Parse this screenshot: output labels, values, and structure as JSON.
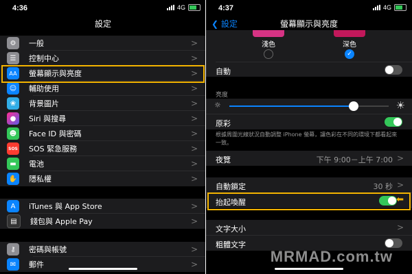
{
  "left": {
    "status_time": "4:36",
    "network": "4G",
    "title": "設定",
    "group1": [
      {
        "label": "一般",
        "icon": "gear-icon",
        "color": "#8e8e93"
      },
      {
        "label": "控制中心",
        "icon": "control-center-icon",
        "color": "#8e8e93"
      },
      {
        "label": "螢幕顯示與亮度",
        "icon": "display-icon",
        "color": "#0a84ff"
      },
      {
        "label": "輔助使用",
        "icon": "accessibility-icon",
        "color": "#0a84ff"
      },
      {
        "label": "背景圖片",
        "icon": "wallpaper-icon",
        "color": "#32ade6"
      },
      {
        "label": "Siri 與搜尋",
        "icon": "siri-icon",
        "color": "#222222"
      },
      {
        "label": "Face ID 與密碼",
        "icon": "faceid-icon",
        "color": "#34c759"
      },
      {
        "label": "SOS 緊急服務",
        "icon": "sos-icon",
        "color": "#ff3b30"
      },
      {
        "label": "電池",
        "icon": "battery-icon",
        "color": "#34c759"
      },
      {
        "label": "隱私權",
        "icon": "hand-icon",
        "color": "#0a84ff"
      }
    ],
    "group2": [
      {
        "label": "iTunes 與 App Store",
        "icon": "appstore-icon",
        "color": "#0a84ff"
      },
      {
        "label": "錢包與 Apple Pay",
        "icon": "wallet-icon",
        "color": "#1c1c1e"
      }
    ],
    "group3": [
      {
        "label": "密碼與帳號",
        "icon": "key-icon",
        "color": "#8e8e93"
      },
      {
        "label": "郵件",
        "icon": "mail-icon",
        "color": "#0a84ff"
      }
    ]
  },
  "right": {
    "status_time": "4:37",
    "network": "4G",
    "back_label": "設定",
    "title": "螢幕顯示與亮度",
    "light_label": "淺色",
    "dark_label": "深色",
    "auto_label": "自動",
    "brightness_section": "亮度",
    "brightness_level": 0.78,
    "true_tone_label": "原彩",
    "true_tone_desc": "根據周圍光線狀況自動調整 iPhone 螢幕，讓色彩在不同的環境下都看起來一致。",
    "night_shift_label": "夜覽",
    "night_shift_value": "下午 9:00－上午 7:00",
    "auto_lock_label": "自動鎖定",
    "auto_lock_value": "30 秒",
    "raise_to_wake_label": "抬起喚醒",
    "text_size_label": "文字大小",
    "bold_text_label": "粗體文字"
  },
  "watermark": "MRMAD.com.tw",
  "colors": {
    "highlight": "#f4b400",
    "accent": "#0a84ff",
    "toggle_on": "#34c759"
  }
}
